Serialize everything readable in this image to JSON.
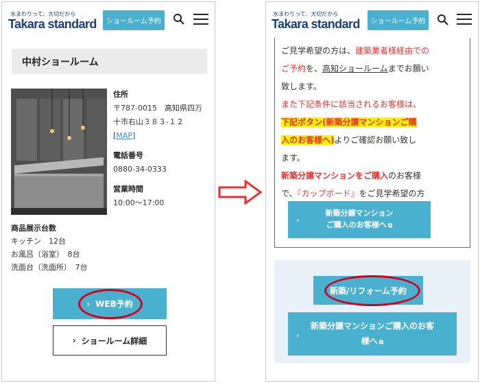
{
  "header": {
    "tagline": "水まわりって、大切だから",
    "logo": "Takara standard",
    "showroom_reserve_btn": "ショールーム予約"
  },
  "left": {
    "section_title": "中村ショールーム",
    "address_label": "住所",
    "address_line1": "〒787-0015　高知県四万",
    "address_line2": "十市右山３８３-１２",
    "map_open": "[",
    "map_link": "MAP",
    "map_close": "]",
    "phone_label": "電話番号",
    "phone": "0880-34-0333",
    "hours_label": "営業時間",
    "hours": "10:00〜17:00",
    "display_title": "商品展示台数",
    "display_items": [
      "キッチン　12台",
      "お風呂（浴室）　8台",
      "洗面台（洗面所）　7台"
    ],
    "web_reserve_btn": "WEB予約",
    "showroom_detail_btn": "ショールーム詳細"
  },
  "right": {
    "p1_a": "ご見学希望の方は、",
    "p1_b": "建築業者様経由での",
    "p1_c": "ご予約",
    "p1_d": "を、",
    "p1_e": "高知ショールーム",
    "p1_f": "までお願い",
    "p1_g": "致します。",
    "p2": "また下記条件に該当されるお客様は、",
    "p3_a": "下記ボタン(新築分譲マンションご購",
    "p3_b": "入のお客様へ)",
    "p3_c": "よりご確認お願い致し",
    "p3_d": "ます。",
    "p4_a": "新築分譲マンションをご購入",
    "p4_b": "のお客様",
    "p4_c": "で、",
    "p4_d": "『カップボード』",
    "p4_e": "をご見学希望の方",
    "inner_btn_line1": "新築分譲マンション",
    "inner_btn_line2": "ご購入のお客様へ",
    "reserve_btn": "新築/リフォーム予約",
    "new_condo_btn_line1": "新築分譲マンションご購入のお客",
    "new_condo_btn_line2": "様へ"
  },
  "colors": {
    "accent": "#4ab0cf",
    "brand": "#1a3d7c",
    "highlight_red": "#e8312f",
    "annotation_red": "#d6001c",
    "highlight_yellow": "#fff200",
    "panel_bg": "#e9f1f8"
  },
  "icons": {
    "search": "search-icon",
    "menu": "hamburger-menu-icon",
    "chevron": "chevron-right-icon",
    "external": "external-link-icon",
    "arrow": "right-arrow-icon"
  }
}
